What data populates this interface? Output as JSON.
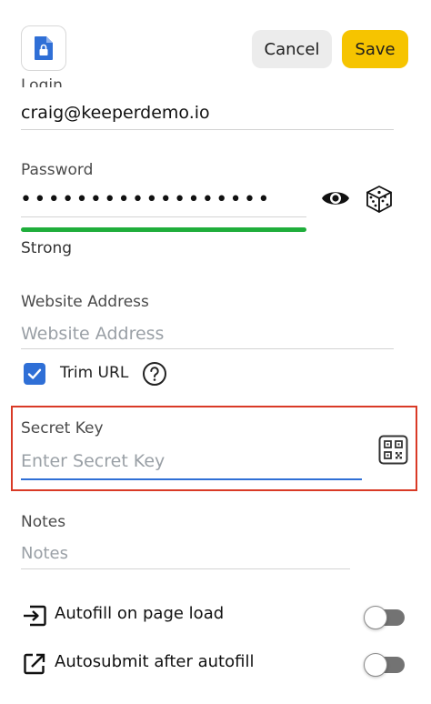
{
  "header": {
    "app_icon": "locked-document-icon",
    "cancel_label": "Cancel",
    "save_label": "Save"
  },
  "login": {
    "value": "craig@keeperdemo.io"
  },
  "password": {
    "label": "Password",
    "masked_value": "••••••••••••••••••",
    "strength_label": "Strong",
    "strength_color": "#1fae3b",
    "reveal_icon": "eye-icon",
    "generate_icon": "dice-icon"
  },
  "website": {
    "label": "Website Address",
    "placeholder": "Website Address",
    "trim_url_label": "Trim URL",
    "trim_url_checked": true,
    "help_icon": "help-circle-icon"
  },
  "secret_key": {
    "label": "Secret Key",
    "placeholder": "Enter Secret Key",
    "scan_icon": "qr-scan-icon",
    "highlight_color": "#d93a26"
  },
  "notes": {
    "label": "Notes",
    "placeholder": "Notes"
  },
  "options": {
    "autofill": {
      "label": "Autofill on page load",
      "icon": "enter-arrow-icon",
      "enabled": false
    },
    "autosubmit": {
      "label": "Autosubmit after autofill",
      "icon": "open-external-icon",
      "enabled": false
    }
  },
  "colors": {
    "accent_yellow": "#f6c400",
    "brand_blue": "#2f6fd6"
  }
}
